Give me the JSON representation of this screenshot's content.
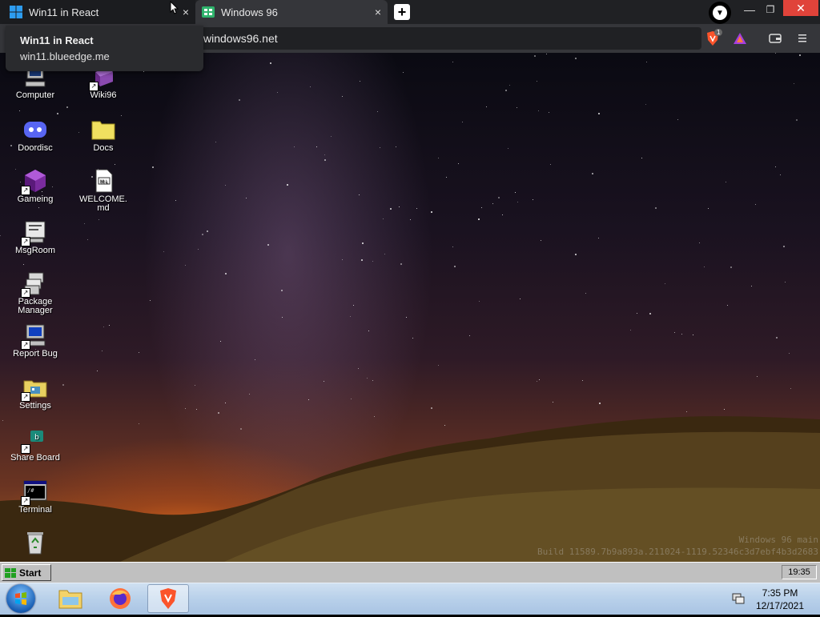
{
  "browser": {
    "tabs": [
      {
        "title": "Win11 in React",
        "icon": "windows-logo-icon",
        "close": "×"
      },
      {
        "title": "Windows 96",
        "icon": "windows96-logo-icon",
        "close": "×"
      }
    ],
    "new_tab": "+",
    "address": "windows96.net",
    "brave_shield_count": "1",
    "tooltip": {
      "title": "Win11 in React",
      "url": "win11.blueedge.me"
    }
  },
  "desktop": {
    "icons": [
      {
        "label": "Computer",
        "icon": "computer-icon"
      },
      {
        "label": "Wiki96",
        "icon": "wiki-book-icon"
      },
      {
        "label": "Doordisc",
        "icon": "discord-icon"
      },
      {
        "label": "Docs",
        "icon": "folder-icon"
      },
      {
        "label": "Gameing",
        "icon": "game-cube-icon"
      },
      {
        "label": "WELCOME.md",
        "icon": "markdown-file-icon"
      },
      {
        "label": "MsgRoom",
        "icon": "msgroom-icon"
      },
      {
        "label": "Package Manager",
        "icon": "package-manager-icon"
      },
      {
        "label": "Report Bug",
        "icon": "report-bug-icon"
      },
      {
        "label": "Settings",
        "icon": "settings-icon"
      },
      {
        "label": "Share Board",
        "icon": "share-board-icon"
      },
      {
        "label": "Terminal",
        "icon": "terminal-icon"
      },
      {
        "label": "",
        "icon": "recycle-bin-icon"
      }
    ],
    "watermark_line1": "Windows 96 main",
    "watermark_line2": "Build 11589.7b9a893a.211024-1119.52346c3d7ebf4b3d2683"
  },
  "w96_taskbar": {
    "start_label": "Start",
    "clock": "19:35"
  },
  "win7_taskbar": {
    "time": "7:35 PM",
    "date": "12/17/2021"
  }
}
